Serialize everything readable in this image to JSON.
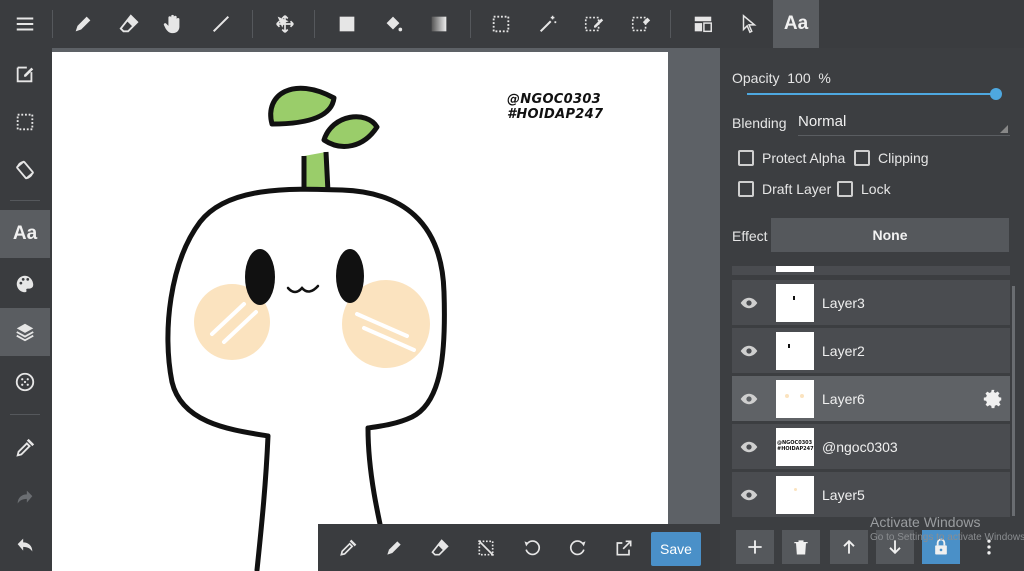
{
  "toolbar": {
    "text_tool_label": "Aa"
  },
  "sidebar": {
    "text_label": "Aa"
  },
  "canvas": {
    "watermark_line1": "@NGOC0303",
    "watermark_line2": "#HOIDAP247"
  },
  "bottombar": {
    "save_label": "Save"
  },
  "panel": {
    "opacity_label": "Opacity",
    "opacity_value": "100",
    "opacity_unit": "%",
    "opacity_percent": 100,
    "blending_label": "Blending",
    "blending_value": "Normal",
    "protect_alpha_label": "Protect Alpha",
    "clipping_label": "Clipping",
    "draft_layer_label": "Draft Layer",
    "lock_label": "Lock",
    "effect_label": "Effect",
    "effect_value": "None"
  },
  "layers": [
    {
      "name": "Layer3"
    },
    {
      "name": "Layer2"
    },
    {
      "name": "Layer6",
      "selected": true
    },
    {
      "name": "@ngoc0303"
    },
    {
      "name": "Layer5"
    }
  ],
  "layer_thumb_text": {
    "line1": "@NGOC0303",
    "line2": "#HOIDAP247"
  },
  "overlay": {
    "activate_title": "Activate Windows",
    "activate_sub": "Go to Settings to activate Windows."
  },
  "colors": {
    "accent": "#4a90c8",
    "slider": "#4ea8e0",
    "sprout_green": "#9acd6a",
    "blush": "#fbe3bf"
  }
}
